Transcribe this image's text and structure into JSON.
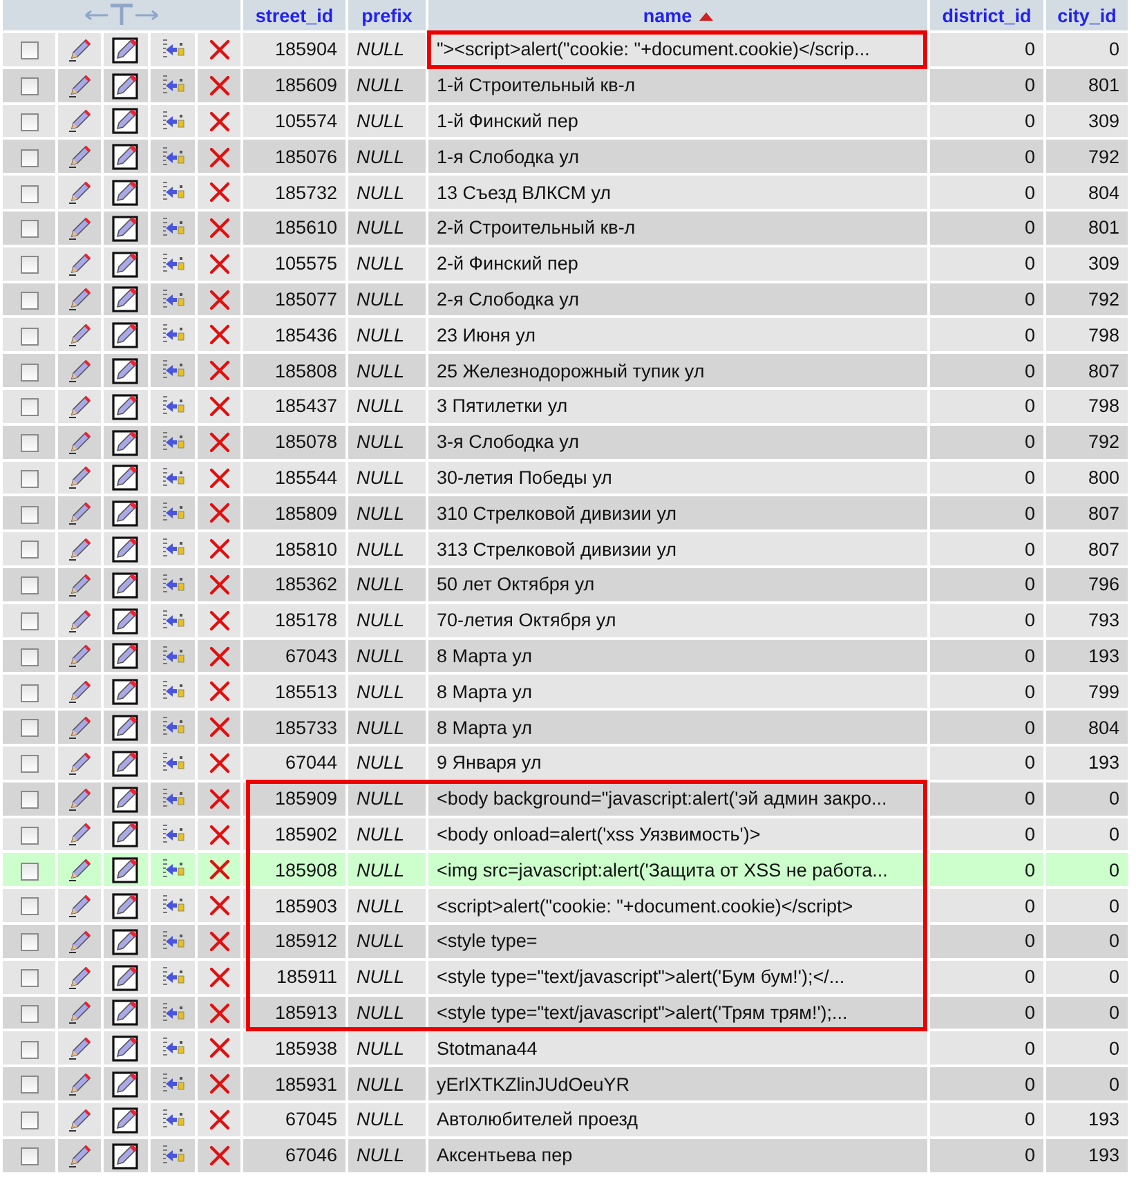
{
  "columns": [
    {
      "label": "street_id",
      "sorted": false
    },
    {
      "label": "prefix",
      "sorted": false
    },
    {
      "label": "name",
      "sorted": true
    },
    {
      "label": "district_id",
      "sorted": false
    },
    {
      "label": "city_id",
      "sorted": false
    }
  ],
  "rows": [
    {
      "checked": false,
      "highlighted": false,
      "outlined": true,
      "outline_covers_ids": false,
      "street_id": "185904",
      "prefix": "NULL",
      "name": "\"><script>alert(\"cookie: \"+document.cookie)</scrip...",
      "district_id": "0",
      "city_id": "0"
    },
    {
      "checked": false,
      "highlighted": false,
      "outlined": false,
      "street_id": "185609",
      "prefix": "NULL",
      "name": "1-й Строительный кв-л",
      "district_id": "0",
      "city_id": "801"
    },
    {
      "checked": false,
      "highlighted": false,
      "outlined": false,
      "street_id": "105574",
      "prefix": "NULL",
      "name": "1-й Финский пер",
      "district_id": "0",
      "city_id": "309"
    },
    {
      "checked": false,
      "highlighted": false,
      "outlined": false,
      "street_id": "185076",
      "prefix": "NULL",
      "name": "1-я Слободка ул",
      "district_id": "0",
      "city_id": "792"
    },
    {
      "checked": false,
      "highlighted": false,
      "outlined": false,
      "street_id": "185732",
      "prefix": "NULL",
      "name": "13 Съезд ВЛКСМ ул",
      "district_id": "0",
      "city_id": "804"
    },
    {
      "checked": false,
      "highlighted": false,
      "outlined": false,
      "street_id": "185610",
      "prefix": "NULL",
      "name": "2-й Строительный кв-л",
      "district_id": "0",
      "city_id": "801"
    },
    {
      "checked": false,
      "highlighted": false,
      "outlined": false,
      "street_id": "105575",
      "prefix": "NULL",
      "name": "2-й Финский пер",
      "district_id": "0",
      "city_id": "309"
    },
    {
      "checked": false,
      "highlighted": false,
      "outlined": false,
      "street_id": "185077",
      "prefix": "NULL",
      "name": "2-я Слободка ул",
      "district_id": "0",
      "city_id": "792"
    },
    {
      "checked": false,
      "highlighted": false,
      "outlined": false,
      "street_id": "185436",
      "prefix": "NULL",
      "name": "23 Июня ул",
      "district_id": "0",
      "city_id": "798"
    },
    {
      "checked": false,
      "highlighted": false,
      "outlined": false,
      "street_id": "185808",
      "prefix": "NULL",
      "name": "25 Железнодорожный тупик ул",
      "district_id": "0",
      "city_id": "807"
    },
    {
      "checked": false,
      "highlighted": false,
      "outlined": false,
      "street_id": "185437",
      "prefix": "NULL",
      "name": "3 Пятилетки ул",
      "district_id": "0",
      "city_id": "798"
    },
    {
      "checked": false,
      "highlighted": false,
      "outlined": false,
      "street_id": "185078",
      "prefix": "NULL",
      "name": "3-я Слободка ул",
      "district_id": "0",
      "city_id": "792"
    },
    {
      "checked": false,
      "highlighted": false,
      "outlined": false,
      "street_id": "185544",
      "prefix": "NULL",
      "name": "30-летия Победы ул",
      "district_id": "0",
      "city_id": "800"
    },
    {
      "checked": false,
      "highlighted": false,
      "outlined": false,
      "street_id": "185809",
      "prefix": "NULL",
      "name": "310 Стрелковой дивизии ул",
      "district_id": "0",
      "city_id": "807"
    },
    {
      "checked": false,
      "highlighted": false,
      "outlined": false,
      "street_id": "185810",
      "prefix": "NULL",
      "name": "313 Стрелковой дивизии ул",
      "district_id": "0",
      "city_id": "807"
    },
    {
      "checked": false,
      "highlighted": false,
      "outlined": false,
      "street_id": "185362",
      "prefix": "NULL",
      "name": "50 лет Октября ул",
      "district_id": "0",
      "city_id": "796"
    },
    {
      "checked": false,
      "highlighted": false,
      "outlined": false,
      "street_id": "185178",
      "prefix": "NULL",
      "name": "70-летия Октября ул",
      "district_id": "0",
      "city_id": "793"
    },
    {
      "checked": false,
      "highlighted": false,
      "outlined": false,
      "street_id": "67043",
      "prefix": "NULL",
      "name": "8 Марта ул",
      "district_id": "0",
      "city_id": "193"
    },
    {
      "checked": false,
      "highlighted": false,
      "outlined": false,
      "street_id": "185513",
      "prefix": "NULL",
      "name": "8 Марта ул",
      "district_id": "0",
      "city_id": "799"
    },
    {
      "checked": false,
      "highlighted": false,
      "outlined": false,
      "street_id": "185733",
      "prefix": "NULL",
      "name": "8 Марта ул",
      "district_id": "0",
      "city_id": "804"
    },
    {
      "checked": false,
      "highlighted": false,
      "outlined": false,
      "street_id": "67044",
      "prefix": "NULL",
      "name": "9 Января ул",
      "district_id": "0",
      "city_id": "193"
    },
    {
      "checked": false,
      "highlighted": false,
      "outlined": true,
      "outline_covers_ids": true,
      "street_id": "185909",
      "prefix": "NULL",
      "name": "<body background=\"javascript:alert('эй админ закро...",
      "district_id": "0",
      "city_id": "0"
    },
    {
      "checked": false,
      "highlighted": false,
      "outlined": true,
      "outline_covers_ids": true,
      "street_id": "185902",
      "prefix": "NULL",
      "name": "<body onload=alert('xss Уязвимость')>",
      "district_id": "0",
      "city_id": "0"
    },
    {
      "checked": false,
      "highlighted": true,
      "outlined": true,
      "outline_covers_ids": true,
      "street_id": "185908",
      "prefix": "NULL",
      "name": "<img src=javascript:alert('Защита от XSS не работа...",
      "district_id": "0",
      "city_id": "0"
    },
    {
      "checked": false,
      "highlighted": false,
      "outlined": true,
      "outline_covers_ids": true,
      "street_id": "185903",
      "prefix": "NULL",
      "name": "<script>alert(\"cookie: \"+document.cookie)</script>",
      "district_id": "0",
      "city_id": "0"
    },
    {
      "checked": false,
      "highlighted": false,
      "outlined": true,
      "outline_covers_ids": true,
      "street_id": "185912",
      "prefix": "NULL",
      "name": "<style type=",
      "district_id": "0",
      "city_id": "0"
    },
    {
      "checked": false,
      "highlighted": false,
      "outlined": true,
      "outline_covers_ids": true,
      "street_id": "185911",
      "prefix": "NULL",
      "name": "<style type=\"text/javascript\">alert('Бум бум!');</...",
      "district_id": "0",
      "city_id": "0"
    },
    {
      "checked": false,
      "highlighted": false,
      "outlined": true,
      "outline_covers_ids": true,
      "street_id": "185913",
      "prefix": "NULL",
      "name": "<style type=\"text/javascript\">alert('Трям трям!');...",
      "district_id": "0",
      "city_id": "0"
    },
    {
      "checked": false,
      "highlighted": false,
      "outlined": false,
      "street_id": "185938",
      "prefix": "NULL",
      "name": "Stotmana44",
      "district_id": "0",
      "city_id": "0"
    },
    {
      "checked": false,
      "highlighted": false,
      "outlined": false,
      "street_id": "185931",
      "prefix": "NULL",
      "name": "yErlXTKZlinJUdOeuYR",
      "district_id": "0",
      "city_id": "0"
    },
    {
      "checked": false,
      "highlighted": false,
      "outlined": false,
      "street_id": "67045",
      "prefix": "NULL",
      "name": "Автолюбителей проезд",
      "district_id": "0",
      "city_id": "193"
    },
    {
      "checked": false,
      "highlighted": false,
      "outlined": false,
      "street_id": "67046",
      "prefix": "NULL",
      "name": "Аксентьева пер",
      "district_id": "0",
      "city_id": "193"
    }
  ]
}
